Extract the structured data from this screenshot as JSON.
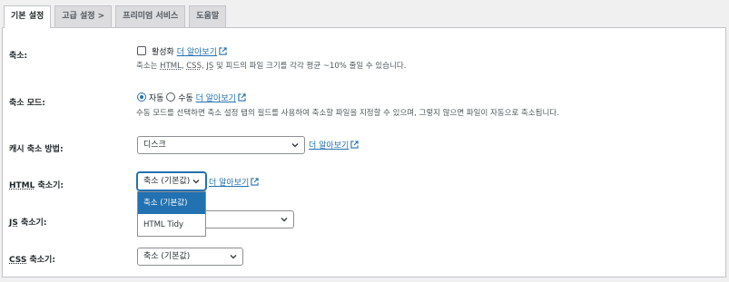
{
  "tabs": [
    {
      "label": "기본 설정"
    },
    {
      "label": "고급 설정 >"
    },
    {
      "label": "프리미엄 서비스"
    },
    {
      "label": "도움말"
    }
  ],
  "more_link": "더 알아보기",
  "minify": {
    "label": "축소:",
    "checkbox_label": "활성화",
    "desc": {
      "p1": "축소는 ",
      "html": "HTML",
      "sep1": ", ",
      "css": "CSS",
      "sep2": ", ",
      "js": "JS",
      "p2": " 및 피드의 파일 크기를 각각 평균 ~10% 줄일 수 있습니다."
    }
  },
  "minify_mode": {
    "label": "축소 모드:",
    "option_auto": "자동",
    "option_manual": "수동",
    "selected": "자동",
    "desc": "수동 모드를 선택하면 축소 설정 탭의 필드를 사용하여 축소할 파일을 지정할 수 있으며, 그렇지 않으면 파일이 자동으로 축소됩니다."
  },
  "cache_method": {
    "label": "캐시 축소 방법:",
    "value": "디스크"
  },
  "html_minifier": {
    "label_abbr": "HTML",
    "label_rest": " 축소기:",
    "value": "축소 (기본값)",
    "options": [
      "축소 (기본값)",
      "HTML Tidy"
    ]
  },
  "js_minifier": {
    "label_abbr": "JS",
    "label_rest": " 축소기:",
    "value": ""
  },
  "css_minifier": {
    "label_abbr": "CSS",
    "label_rest": " 축소기:",
    "value": "축소 (기본값)"
  },
  "colors": {
    "link": "#2271b1",
    "selected_option": "#2271b1"
  }
}
